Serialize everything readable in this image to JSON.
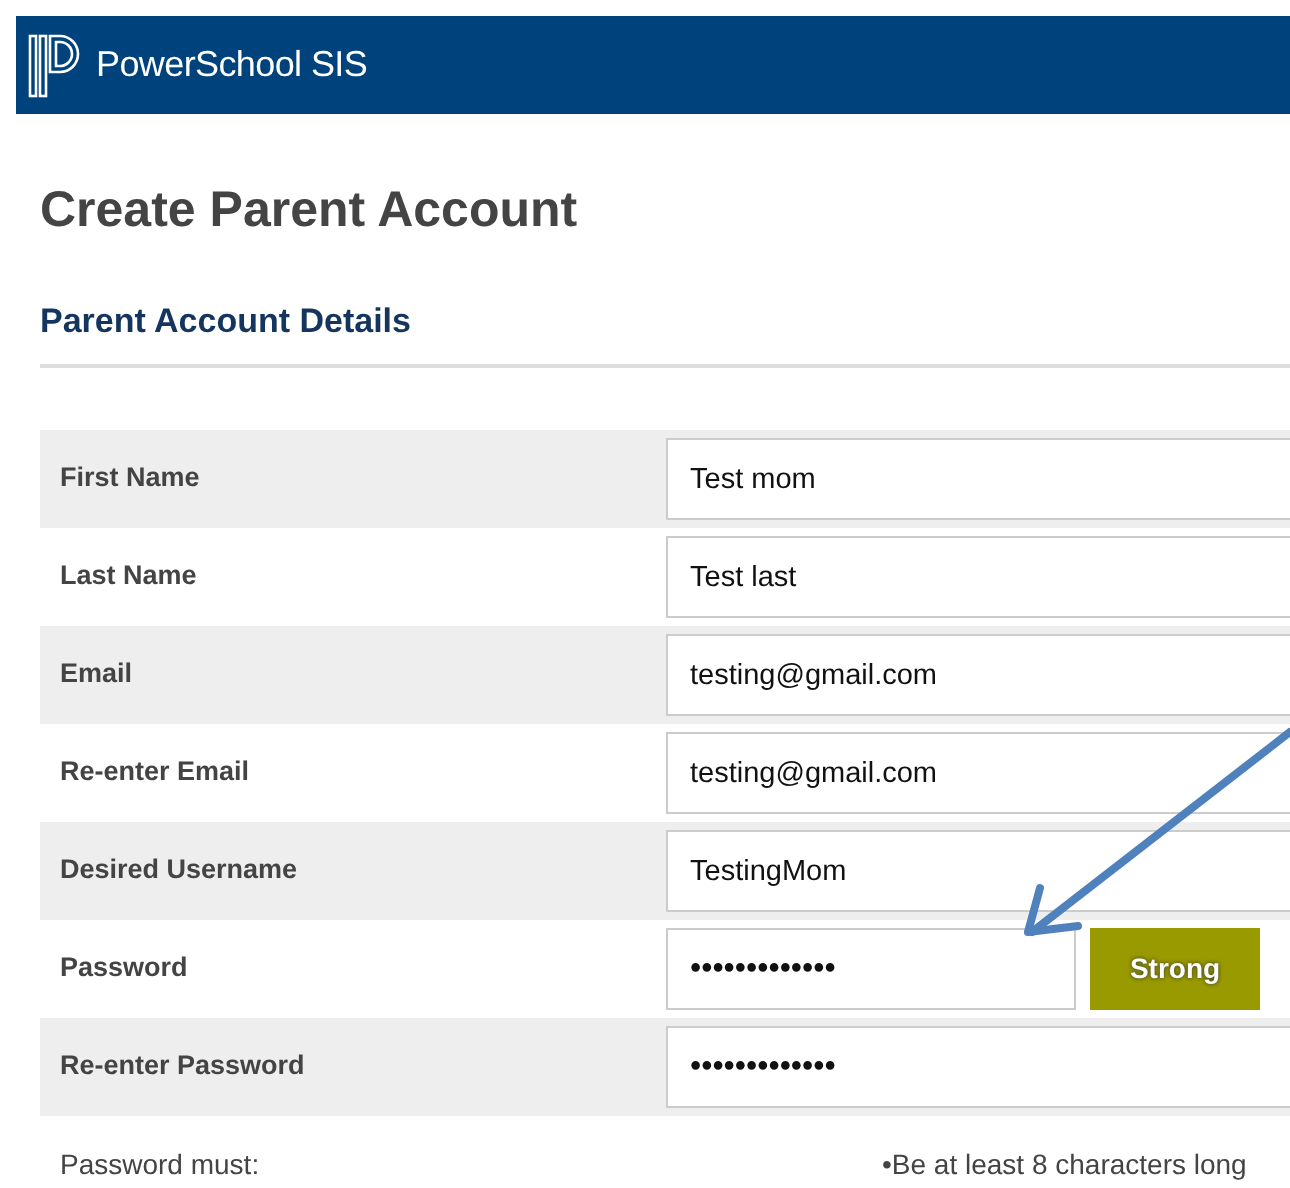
{
  "header": {
    "title": "PowerSchool SIS"
  },
  "page_title": "Create Parent Account",
  "section_title": "Parent Account Details",
  "fields": [
    {
      "label": "First Name",
      "value": "Test mom",
      "kind": "text"
    },
    {
      "label": "Last Name",
      "value": "Test last",
      "kind": "text"
    },
    {
      "label": "Email",
      "value": "testing@gmail.com",
      "kind": "text"
    },
    {
      "label": "Re-enter Email",
      "value": "testing@gmail.com",
      "kind": "text"
    },
    {
      "label": "Desired Username",
      "value": "TestingMom",
      "kind": "text"
    },
    {
      "label": "Password",
      "value": "•••••••••••••",
      "kind": "password",
      "strength": "Strong"
    },
    {
      "label": "Re-enter Password",
      "value": "•••••••••••••",
      "kind": "password"
    }
  ],
  "password_rules": {
    "label": "Password must:",
    "items": [
      "•Be at least 8 characters long"
    ]
  }
}
